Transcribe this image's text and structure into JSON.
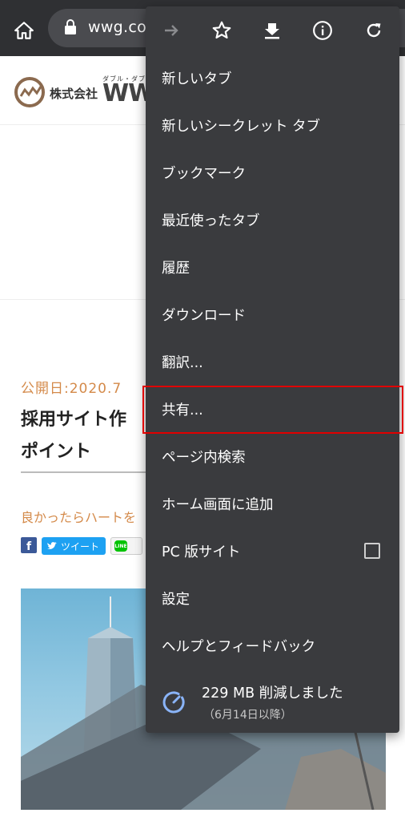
{
  "toolbar": {
    "url": "wwg.co."
  },
  "page": {
    "logo_company": "株式会社",
    "logo_sub": "ダブル・ダブ",
    "logo_big": "WW",
    "publish_date": "公開日:2020.7",
    "title_line1": "採用サイト作",
    "title_line2": "ポイント",
    "heart_text": "良かったらハートを",
    "tweet_label": "ツイート",
    "fb_label": "f",
    "line_label": "LINE"
  },
  "menu": {
    "items": [
      {
        "label": "新しいタブ"
      },
      {
        "label": "新しいシークレット タブ"
      },
      {
        "label": "ブックマーク"
      },
      {
        "label": "最近使ったタブ"
      },
      {
        "label": "履歴"
      },
      {
        "label": "ダウンロード"
      },
      {
        "label": "翻訳..."
      },
      {
        "label": "共有..."
      },
      {
        "label": "ページ内検索"
      },
      {
        "label": "ホーム画面に追加"
      },
      {
        "label": "PC 版サイト"
      },
      {
        "label": "設定"
      },
      {
        "label": "ヘルプとフィードバック"
      }
    ],
    "pc_site_checked": false,
    "data_saver": {
      "main": "229 MB 削減しました",
      "sub": "（6月14日以降）"
    }
  },
  "colors": {
    "toolbar_bg": "#2f3033",
    "menu_bg": "#3a3b3e",
    "accent_orange": "#d48a4a",
    "highlight_red": "#e00000",
    "saver_blue": "#8ab4f8"
  }
}
